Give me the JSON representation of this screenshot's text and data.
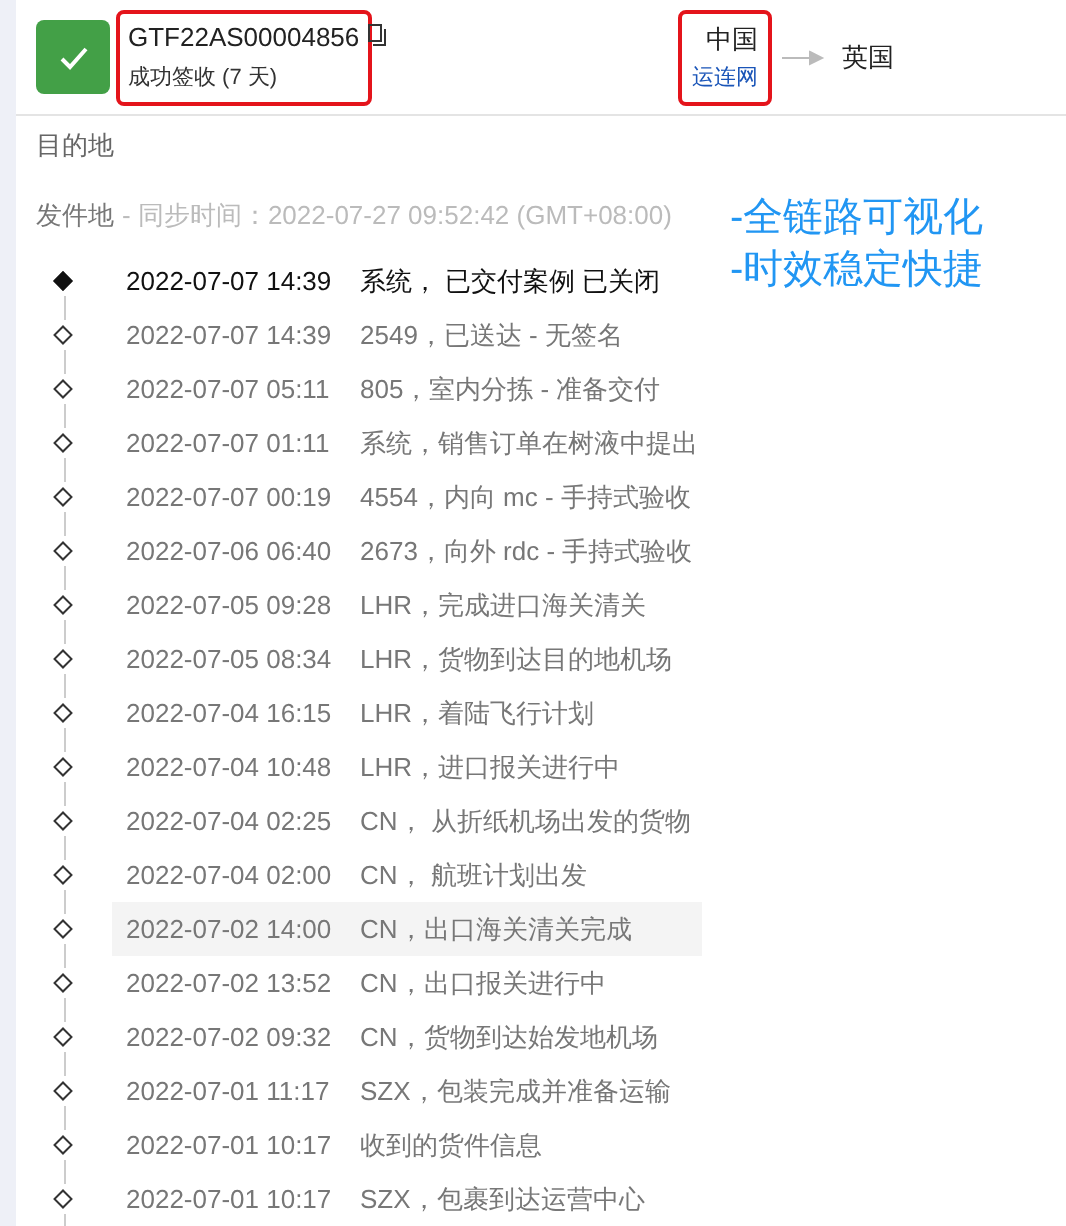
{
  "shipment": {
    "tracking_number": "GTF22AS00004856",
    "status": "成功签收 (7 天)",
    "delivered": true,
    "origin": "中国",
    "carrier": "运连网",
    "destination": "英国"
  },
  "destination_label": "目的地",
  "origin_label": "发件地",
  "sync_time": "- 同步时间：2022-07-27 09:52:42 (GMT+08:00)",
  "annotations": [
    "-全链路可视化",
    "-时效稳定快捷"
  ],
  "events": [
    {
      "time": "2022-07-07 14:39",
      "text": "系统， 已交付案例 已关闭",
      "current": true,
      "selected": false
    },
    {
      "time": "2022-07-07 14:39",
      "text": "2549，已送达 - 无签名",
      "current": false,
      "selected": false
    },
    {
      "time": "2022-07-07 05:11",
      "text": "805，室内分拣 - 准备交付",
      "current": false,
      "selected": false
    },
    {
      "time": "2022-07-07 01:11",
      "text": "系统，销售订单在树液中提出",
      "current": false,
      "selected": false
    },
    {
      "time": "2022-07-07 00:19",
      "text": "4554，内向 mc - 手持式验收",
      "current": false,
      "selected": false
    },
    {
      "time": "2022-07-06 06:40",
      "text": "2673，向外 rdc - 手持式验收",
      "current": false,
      "selected": false
    },
    {
      "time": "2022-07-05 09:28",
      "text": "LHR，完成进口海关清关",
      "current": false,
      "selected": false
    },
    {
      "time": "2022-07-05 08:34",
      "text": "LHR，货物到达目的地机场",
      "current": false,
      "selected": false
    },
    {
      "time": "2022-07-04 16:15",
      "text": "LHR，着陆飞行计划",
      "current": false,
      "selected": false
    },
    {
      "time": "2022-07-04 10:48",
      "text": "LHR，进口报关进行中",
      "current": false,
      "selected": false
    },
    {
      "time": "2022-07-04 02:25",
      "text": "CN， 从折纸机场出发的货物",
      "current": false,
      "selected": false
    },
    {
      "time": "2022-07-04 02:00",
      "text": "CN， 航班计划出发",
      "current": false,
      "selected": false
    },
    {
      "time": "2022-07-02 14:00",
      "text": "CN，出口海关清关完成",
      "current": false,
      "selected": true
    },
    {
      "time": "2022-07-02 13:52",
      "text": "CN，出口报关进行中",
      "current": false,
      "selected": false
    },
    {
      "time": "2022-07-02 09:32",
      "text": "CN，货物到达始发地机场",
      "current": false,
      "selected": false
    },
    {
      "time": "2022-07-01 11:17",
      "text": "SZX，包装完成并准备运输",
      "current": false,
      "selected": false
    },
    {
      "time": "2022-07-01 10:17",
      "text": "收到的货件信息",
      "current": false,
      "selected": false
    },
    {
      "time": "2022-07-01 10:17",
      "text": "SZX，包裹到达运营中心",
      "current": false,
      "selected": false
    }
  ]
}
